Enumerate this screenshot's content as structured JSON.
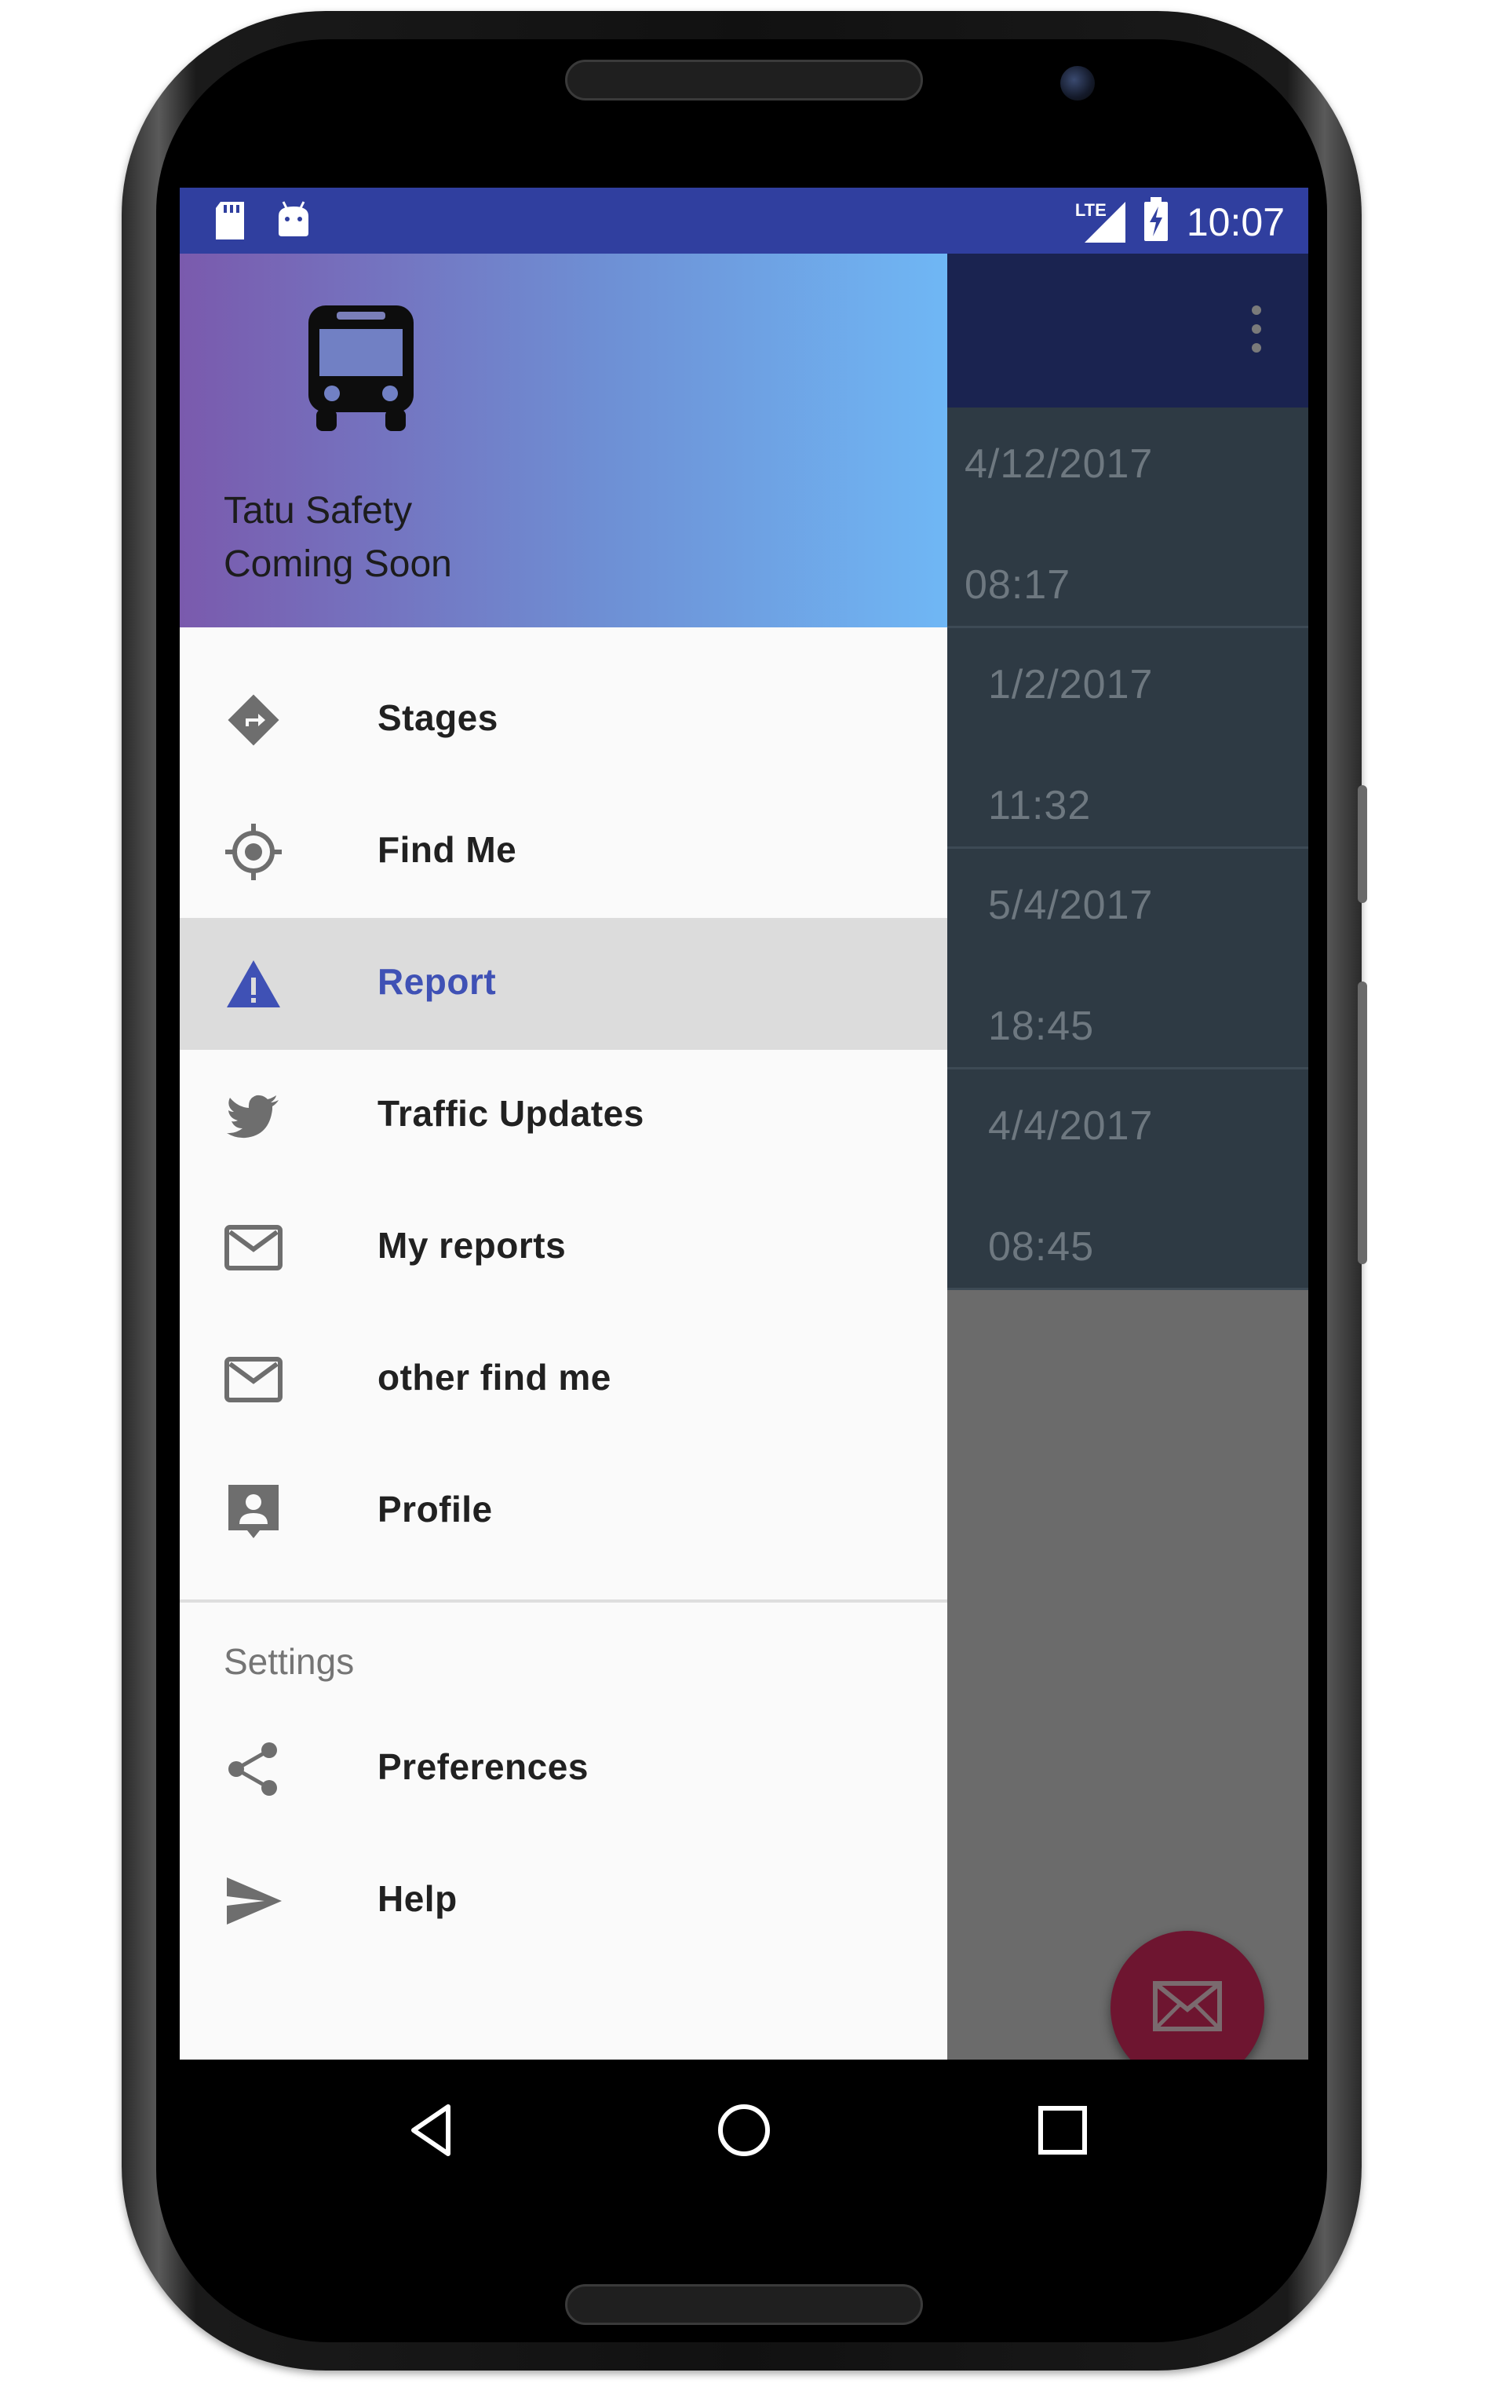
{
  "status_bar": {
    "time": "10:07",
    "network": "LTE",
    "left_icons": [
      "sd-card-icon",
      "android-icon"
    ],
    "right_icons": [
      "lte-signal-icon",
      "battery-charging-icon"
    ],
    "color": "#303f9f"
  },
  "app": {
    "toolbar_color": "#1a2350",
    "list": [
      {
        "date": "4/12/2017",
        "time": "08:17"
      },
      {
        "date": "1/2/2017",
        "time": "11:32"
      },
      {
        "date": "5/4/2017",
        "time": "18:45"
      },
      {
        "date": "4/4/2017",
        "time": "08:45"
      }
    ],
    "fab_icon": "mail-icon"
  },
  "drawer": {
    "header": {
      "icon": "bus-icon",
      "title": "Tatu Safety",
      "subtitle": "Coming Soon"
    },
    "items": [
      {
        "label": "Stages",
        "icon": "directions-icon",
        "active": false
      },
      {
        "label": "Find Me",
        "icon": "gps-target-icon",
        "active": false
      },
      {
        "label": "Report",
        "icon": "warning-icon",
        "active": true
      },
      {
        "label": "Traffic Updates",
        "icon": "twitter-bird-icon",
        "active": false
      },
      {
        "label": "My reports",
        "icon": "mail-icon",
        "active": false
      },
      {
        "label": "other find me",
        "icon": "mail-icon",
        "active": false
      },
      {
        "label": "Profile",
        "icon": "contact-card-icon",
        "active": false
      }
    ],
    "settings_section": {
      "title": "Settings",
      "items": [
        {
          "label": "Preferences",
          "icon": "share-icon"
        },
        {
          "label": "Help",
          "icon": "send-icon"
        }
      ]
    },
    "accent_color": "#3f51b5"
  },
  "nav_bar": {
    "buttons": [
      "back-icon",
      "home-icon",
      "recents-icon"
    ]
  }
}
